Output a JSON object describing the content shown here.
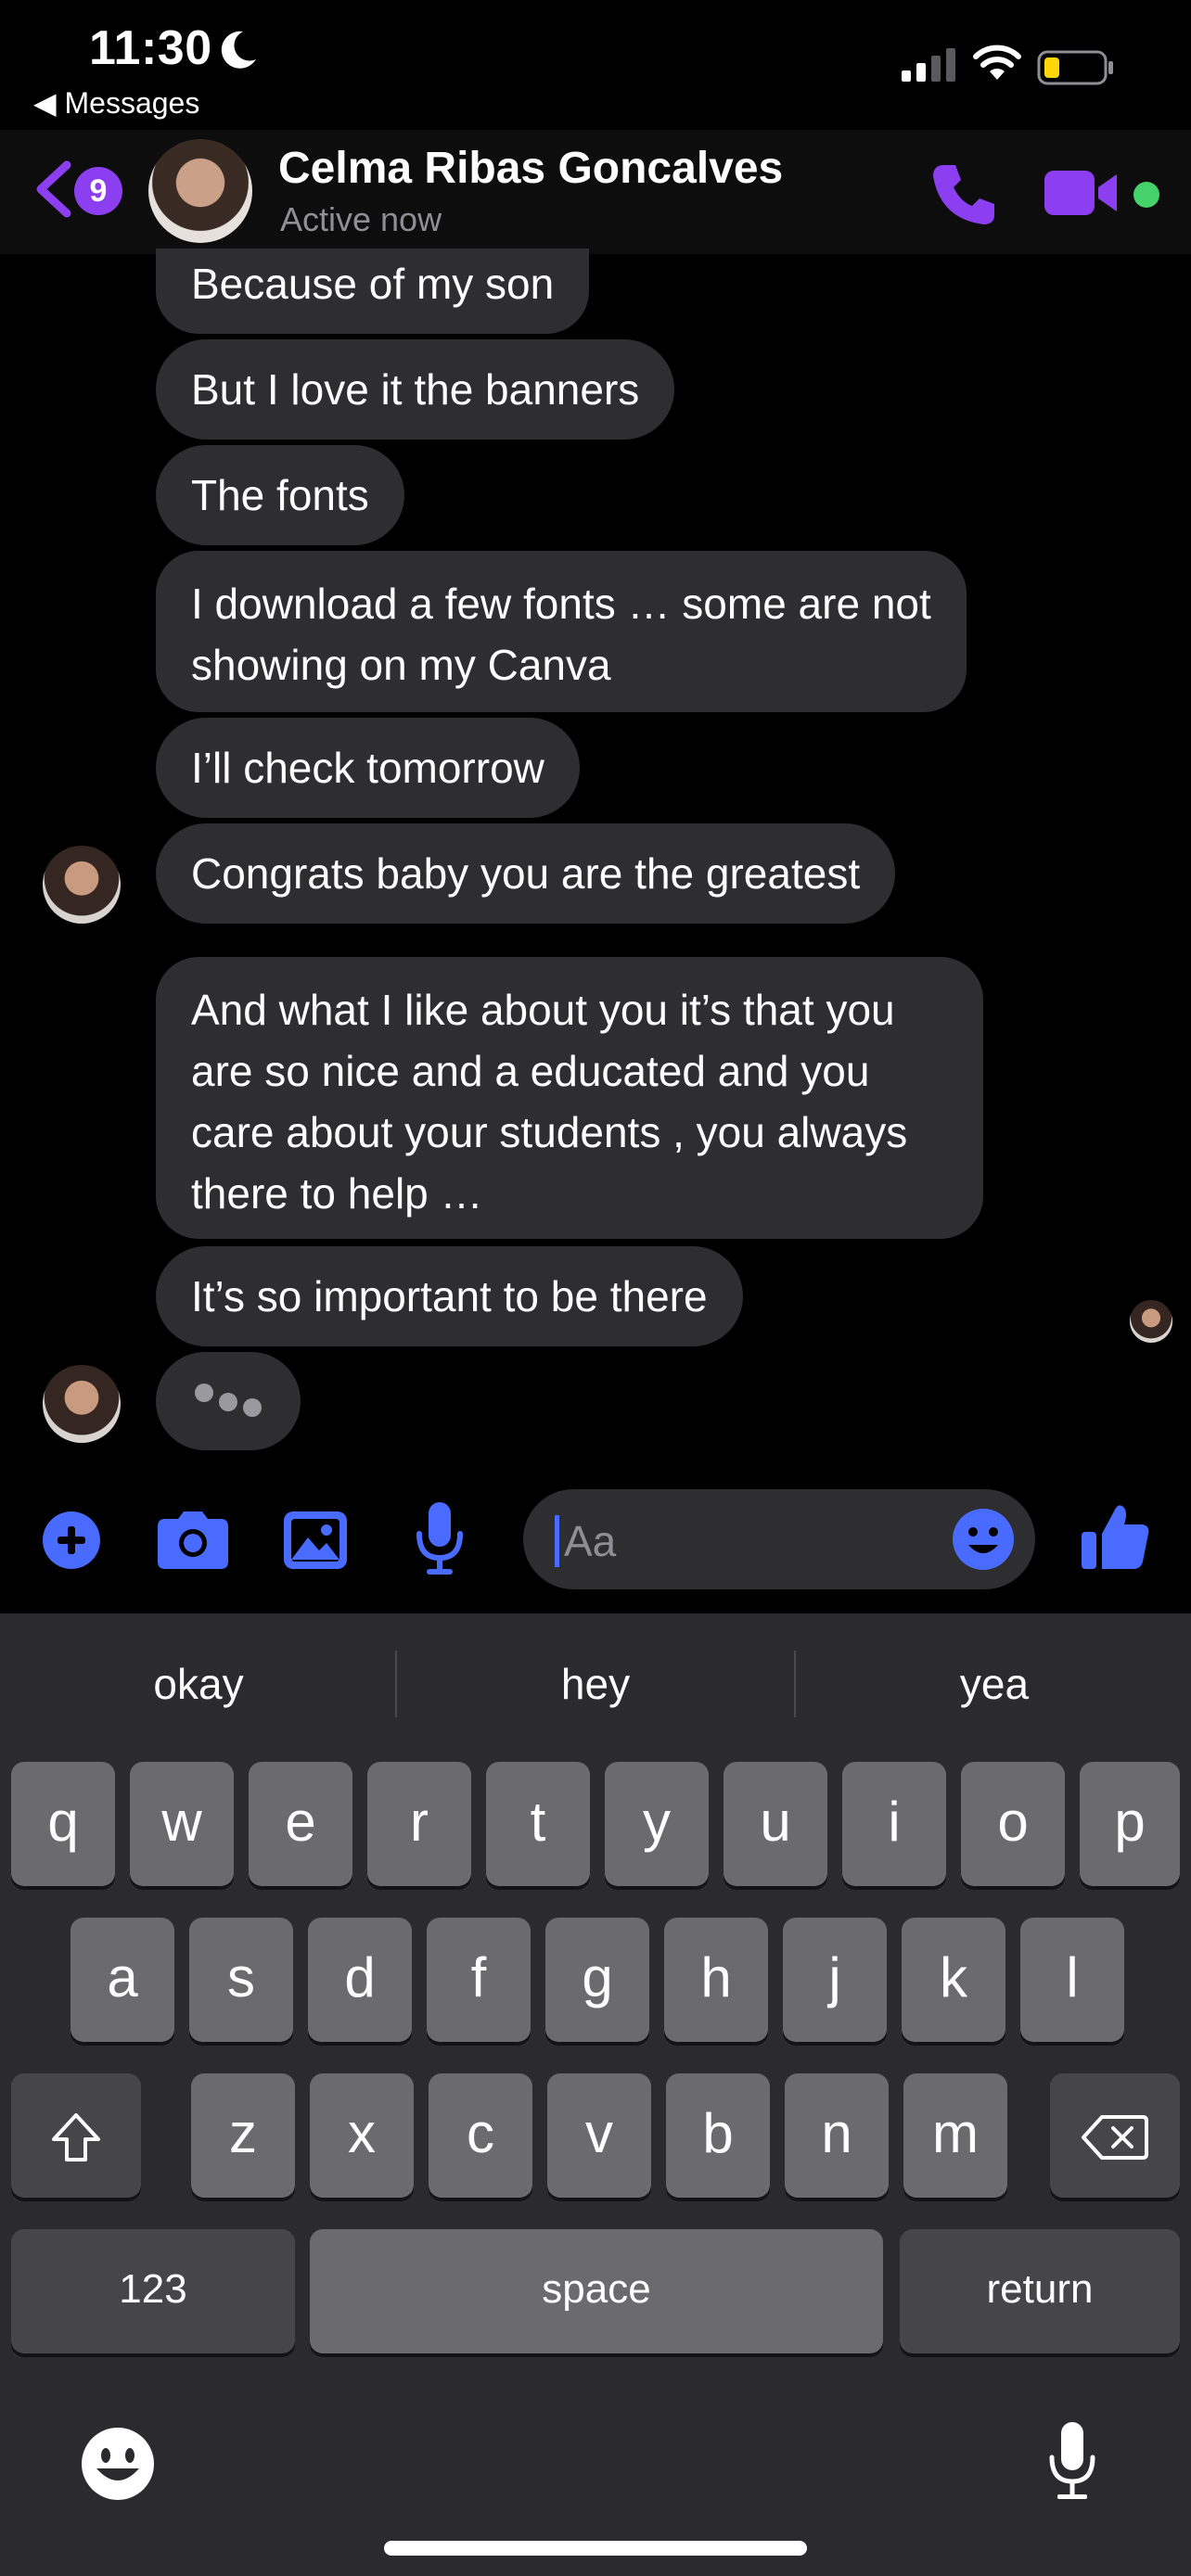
{
  "status_bar": {
    "time": "11:30",
    "back_app": "Messages"
  },
  "header": {
    "unread_count": "9",
    "contact_name": "Celma Ribas Goncalves",
    "contact_status": "Active now"
  },
  "messages": [
    "Because of my son",
    "But I love it the banners",
    "The fonts",
    "I download a few fonts … some are not showing on my Canva",
    "I’ll check tomorrow",
    "Congrats baby you are the greatest",
    "And what I like about you it’s that you are so nice and a educated and you care about your students , you always there to help …",
    "It’s so important to be there"
  ],
  "composer": {
    "placeholder": "Aa"
  },
  "keyboard": {
    "suggestions": [
      "okay",
      "hey",
      "yea"
    ],
    "row1": [
      "q",
      "w",
      "e",
      "r",
      "t",
      "y",
      "u",
      "i",
      "o",
      "p"
    ],
    "row2": [
      "a",
      "s",
      "d",
      "f",
      "g",
      "h",
      "j",
      "k",
      "l"
    ],
    "row3": [
      "z",
      "x",
      "c",
      "v",
      "b",
      "n",
      "m"
    ],
    "numbers_key": "123",
    "space_key": "space",
    "return_key": "return"
  },
  "colors": {
    "accent_purple": "#8c3ff1",
    "accent_blue": "#4a6bff",
    "bubble": "#2e2e30",
    "online": "#45d26a"
  },
  "icons": [
    "moon-icon",
    "signal-icon",
    "wifi-icon",
    "battery-icon",
    "back-chevron-icon",
    "phone-icon",
    "video-icon",
    "plus-icon",
    "camera-icon",
    "gallery-icon",
    "microphone-icon",
    "emoji-icon",
    "thumbs-up-icon",
    "shift-icon",
    "backspace-icon",
    "keyboard-emoji-icon",
    "dictation-icon"
  ]
}
